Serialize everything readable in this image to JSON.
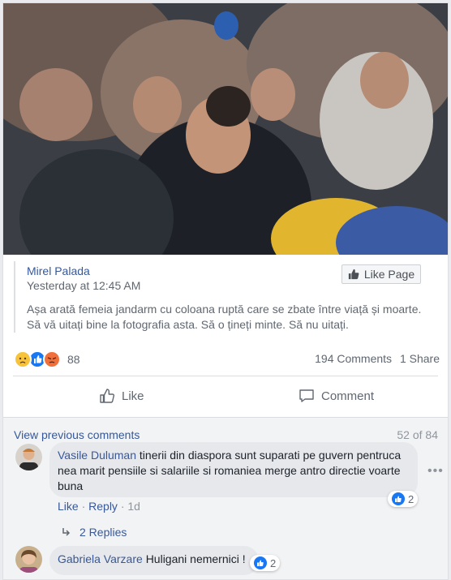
{
  "post": {
    "page_name": "Mirel Palada",
    "timestamp": "Yesterday at 12:45 AM",
    "like_page_label": "Like Page",
    "text": "Așa arată femeia jandarm cu coloana ruptă care se zbate între viață și moarte. Să vă uitați bine la fotografia asta. Să o țineți minte. Să nu uitați."
  },
  "stats": {
    "reaction_count": "88",
    "comments": "194 Comments",
    "shares": "1 Share",
    "reaction_icons": [
      "sad",
      "like",
      "angry"
    ]
  },
  "actions": {
    "like": "Like",
    "comment": "Comment"
  },
  "comments_section": {
    "view_previous": "View previous comments",
    "count": "52 of 84",
    "comments": [
      {
        "author": "Vasile Duluman",
        "text": "tinerii din diaspora sunt suparati pe guvern pentruca nea marit pensiile si salariile si romaniea merge antro directie voarte buna",
        "like": "Like",
        "reply": "Reply",
        "age": "1d",
        "reactions": "2",
        "replies_label": "2 Replies"
      },
      {
        "author": "Gabriela Varzare",
        "text": "Huligani nemernici !",
        "reactions": "2"
      }
    ]
  },
  "colors": {
    "link": "#365899",
    "like_blue": "#1877f2",
    "angry_orange": "#f0703b",
    "sad_yellow": "#f7c33b"
  }
}
